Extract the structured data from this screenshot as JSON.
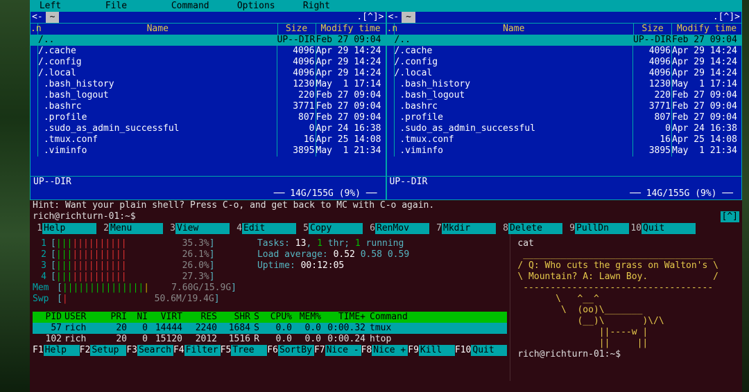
{
  "menu": {
    "items": [
      "Left",
      "File",
      "Command",
      "Options",
      "Right"
    ]
  },
  "panel_title": "~",
  "panel_topicons": {
    "left": "<-",
    "right_left": ".[^]>",
    "right_right": ".[^]>"
  },
  "columns": {
    "n": ".n",
    "name": "Name",
    "size": "Size",
    "modify": "Modify time"
  },
  "files": [
    {
      "name": "/..",
      "size": "UP--DIR",
      "mod": "Feb 27 09:04",
      "sel": true
    },
    {
      "name": "/.cache",
      "size": "4096",
      "mod": "Apr 29 14:24"
    },
    {
      "name": "/.config",
      "size": "4096",
      "mod": "Apr 29 14:24"
    },
    {
      "name": "/.local",
      "size": "4096",
      "mod": "Apr 29 14:24"
    },
    {
      "name": " .bash_history",
      "size": "1230",
      "mod": "May  1 17:14"
    },
    {
      "name": " .bash_logout",
      "size": "220",
      "mod": "Feb 27 09:04"
    },
    {
      "name": " .bashrc",
      "size": "3771",
      "mod": "Feb 27 09:04"
    },
    {
      "name": " .profile",
      "size": "807",
      "mod": "Feb 27 09:04"
    },
    {
      "name": " .sudo_as_admin_successful",
      "size": "0",
      "mod": "Apr 24 16:38"
    },
    {
      "name": " .tmux.conf",
      "size": "16",
      "mod": "Apr 25 14:08"
    },
    {
      "name": " .viminfo",
      "size": "3895",
      "mod": "May  1 21:34"
    }
  ],
  "panel_status": "UP--DIR",
  "panel_disk": "14G/155G (9%)",
  "hint": "Hint: Want your plain shell? Press C-o, and get back to MC with C-o again.",
  "prompt": "rich@richturn-01:~$",
  "prompt_flag": "[^]",
  "mc_fkeys": [
    {
      "n": "1",
      "l": "Help"
    },
    {
      "n": "2",
      "l": "Menu"
    },
    {
      "n": "3",
      "l": "View"
    },
    {
      "n": "4",
      "l": "Edit"
    },
    {
      "n": "5",
      "l": "Copy"
    },
    {
      "n": "6",
      "l": "RenMov"
    },
    {
      "n": "7",
      "l": "Mkdir"
    },
    {
      "n": "8",
      "l": "Delete"
    },
    {
      "n": "9",
      "l": "PullDn"
    },
    {
      "n": "10",
      "l": "Quit"
    }
  ],
  "htop": {
    "cpus": [
      {
        "n": "1",
        "pct": "35.3%"
      },
      {
        "n": "2",
        "pct": "26.1%"
      },
      {
        "n": "3",
        "pct": "26.0%"
      },
      {
        "n": "4",
        "pct": "27.3%"
      }
    ],
    "mem": {
      "label": "Mem",
      "usage": "7.60G/15.9G"
    },
    "swp": {
      "label": "Swp",
      "usage": "50.6M/19.4G"
    },
    "tasks_line": "Tasks: 13, 1 thr; 1 running",
    "load_line": "Load average: 0.52 0.58 0.59",
    "uptime_line": "Uptime: 00:12:05",
    "head": {
      "pid": "PID",
      "user": "USER",
      "pri": "PRI",
      "ni": "NI",
      "virt": "VIRT",
      "res": "RES",
      "shr": "SHR",
      "s": "S",
      "cpu": "CPU%",
      "mem": "MEM%",
      "time": "TIME+",
      "cmd": "Command"
    },
    "procs": [
      {
        "pid": "57",
        "user": "rich",
        "pri": "20",
        "ni": "0",
        "virt": "14444",
        "res": "2240",
        "shr": "1684",
        "s": "S",
        "cpu": "0.0",
        "mem": "0.0",
        "time": "0:00.32",
        "cmd": "tmux",
        "sel": true
      },
      {
        "pid": "102",
        "user": "rich",
        "pri": "20",
        "ni": "0",
        "virt": "15120",
        "res": "2012",
        "shr": "1516",
        "s": "R",
        "cpu": "0.0",
        "mem": "0.0",
        "time": "0:00.24",
        "cmd": "htop"
      }
    ],
    "fkeys": [
      {
        "n": "F1",
        "l": "Help"
      },
      {
        "n": "F2",
        "l": "Setup"
      },
      {
        "n": "F3",
        "l": "Search"
      },
      {
        "n": "F4",
        "l": "Filter"
      },
      {
        "n": "F5",
        "l": "Tree"
      },
      {
        "n": "F6",
        "l": "SortBy"
      },
      {
        "n": "F7",
        "l": "Nice -"
      },
      {
        "n": "F8",
        "l": "Nice +"
      },
      {
        "n": "F9",
        "l": "Kill"
      },
      {
        "n": "F10",
        "l": "Quit"
      }
    ]
  },
  "cow": {
    "cmd": "cat",
    "joke_top": "/ Q: Who cuts the grass on Walton's \\",
    "joke_bot": "\\ Mountain? A: Lawn Boy.            /",
    "dash_top": " ___________________________________",
    "dash_bot": " -----------------------------------",
    "art": [
      "       \\   ^__^",
      "        \\  (oo)\\_______",
      "           (__)\\       )\\/\\",
      "               ||----w |",
      "               ||     ||"
    ],
    "prompt": "rich@richturn-01:~$"
  }
}
